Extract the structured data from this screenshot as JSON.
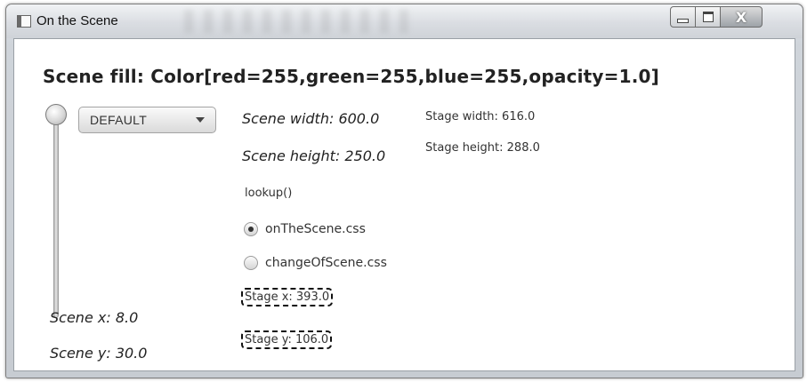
{
  "window": {
    "title": "On the Scene",
    "icons": {
      "app": "app-window-icon",
      "minimize": "minimize-icon",
      "maximize": "maximize-icon",
      "close": "close-icon"
    },
    "close_glyph": "X"
  },
  "scene": {
    "fill_text": "Scene fill: Color[red=255,green=255,blue=255,opacity=1.0]",
    "width_text": "Scene width: 600.0",
    "height_text": "Scene height: 250.0",
    "x_text": "Scene x: 8.0",
    "y_text": "Scene y: 30.0"
  },
  "stage": {
    "width_text": "Stage width: 616.0",
    "height_text": "Stage height: 288.0",
    "x_text": "Stage x: 393.0",
    "y_text": "Stage y: 106.0"
  },
  "controls": {
    "combo_value": "DEFAULT",
    "lookup_label": "lookup()",
    "radios": [
      {
        "label": "onTheScene.css",
        "selected": true
      },
      {
        "label": "changeOfScene.css",
        "selected": false
      }
    ],
    "slider": {
      "value_fraction": 1.0
    }
  }
}
